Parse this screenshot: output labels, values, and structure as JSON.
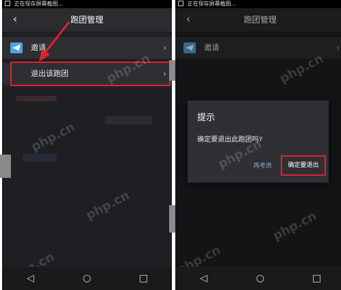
{
  "status_bar": {
    "text": "正在保存屏幕截图..."
  },
  "screen": {
    "title": "跑团管理",
    "back_icon": "chevron-left-icon",
    "items": [
      {
        "label": "邀请",
        "icon": "telegram-send-icon"
      },
      {
        "label": "退出该跑团",
        "icon": "none"
      }
    ]
  },
  "dialog": {
    "title": "提示",
    "message": "确定要退出此跑团吗?",
    "cancel_label": "再考虑",
    "confirm_label": "确定要退出"
  },
  "nav": {
    "back": "◁",
    "home": "○",
    "recents": "□"
  },
  "watermark": "php.cn",
  "colors": {
    "highlight": "#e3202c",
    "accent": "#4fa3df"
  }
}
